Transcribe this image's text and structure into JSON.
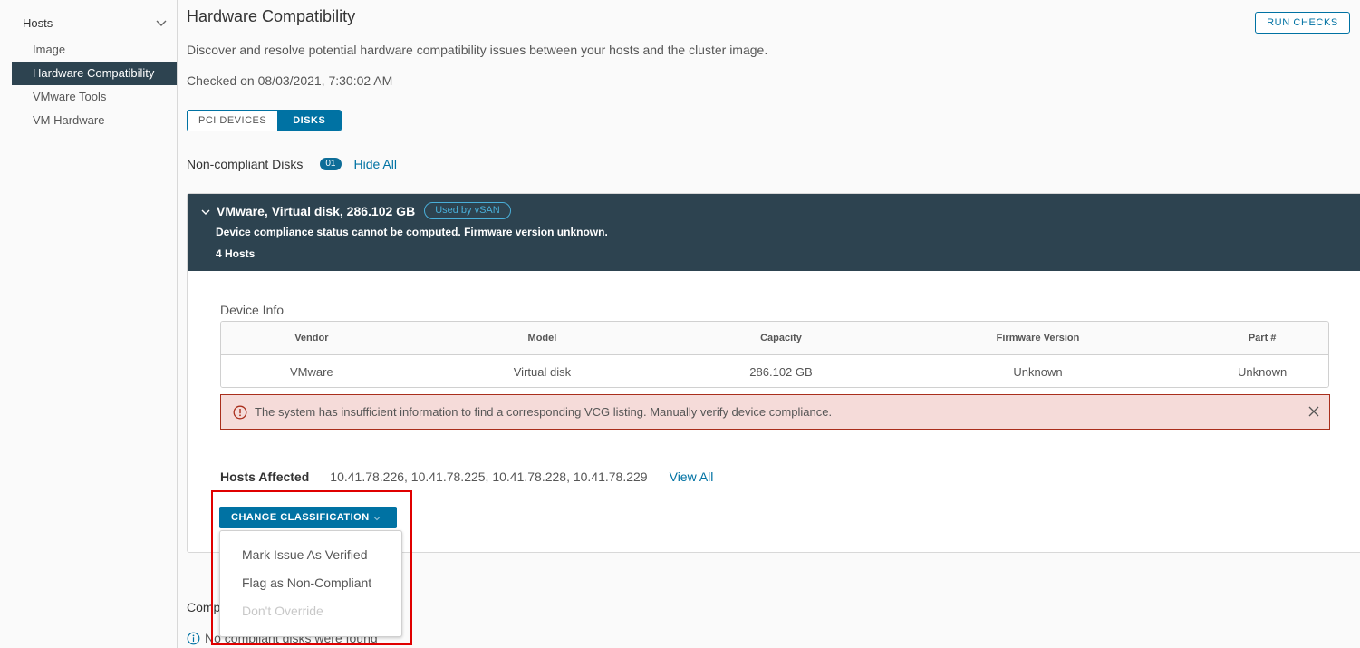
{
  "sidebar": {
    "group_label": "Hosts",
    "items": [
      {
        "label": "Image"
      },
      {
        "label": "Hardware Compatibility",
        "active": true
      },
      {
        "label": "VMware Tools"
      },
      {
        "label": "VM Hardware"
      }
    ]
  },
  "header": {
    "title": "Hardware Compatibility",
    "run_checks_label": "RUN CHECKS",
    "description": "Discover and resolve potential hardware compatibility issues between your hosts and the cluster image.",
    "checked_on": "Checked on 08/03/2021, 7:30:02 AM"
  },
  "tabs": [
    {
      "label": "PCI DEVICES",
      "active": false
    },
    {
      "label": "DISKS",
      "active": true
    }
  ],
  "non_compliant": {
    "label": "Non-compliant Disks",
    "count": "01",
    "hide_all_label": "Hide All"
  },
  "disk_card": {
    "title": "VMware, Virtual disk, 286.102 GB",
    "badge": "Used by vSAN",
    "status": "Device compliance status cannot be computed. Firmware version unknown.",
    "hosts_count": "4 Hosts",
    "device_info_label": "Device Info",
    "table": {
      "headers": [
        "Vendor",
        "Model",
        "Capacity",
        "Firmware Version",
        "Part #"
      ],
      "row": [
        "VMware",
        "Virtual disk",
        "286.102 GB",
        "Unknown",
        "Unknown"
      ]
    },
    "alert": {
      "text": "The system has insufficient information to find a corresponding VCG listing. Manually verify device compliance.",
      "color": "#a92e1c"
    },
    "hosts_affected_label": "Hosts Affected",
    "hosts_affected": "10.41.78.226, 10.41.78.225, 10.41.78.228, 10.41.78.229",
    "view_all_label": "View All"
  },
  "classification": {
    "button_label": "CHANGE CLASSIFICATION",
    "options": [
      {
        "label": "Mark Issue As Verified",
        "disabled": false
      },
      {
        "label": "Flag as Non-Compliant",
        "disabled": false
      },
      {
        "label": "Don't Override",
        "disabled": true
      }
    ]
  },
  "compliant": {
    "label": "Compliant Disks",
    "empty_message": "No compliant disks were found"
  },
  "colors": {
    "accent": "#0072a3",
    "header_dark": "#2d4350",
    "alert_bg": "#f5dbd9",
    "highlight": "#e00000"
  }
}
